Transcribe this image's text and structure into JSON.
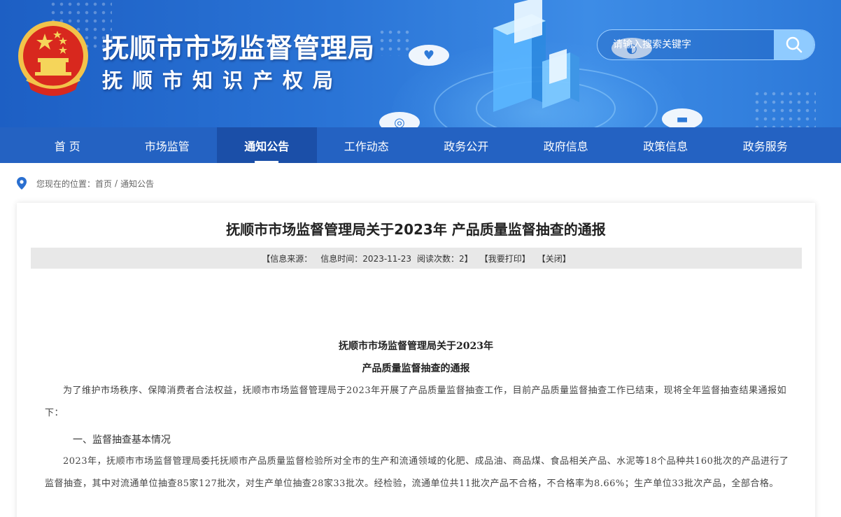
{
  "header": {
    "title_main": "抚顺市市场监督管理局",
    "title_sub": "抚顺市知识产权局",
    "search_placeholder": "请输入搜索关键字",
    "emblem_icon": "national-emblem-icon",
    "search_icon": "search-icon",
    "colors": {
      "banner": "#2a74d6",
      "nav": "#2462c2",
      "nav_active": "#1b4fa8"
    }
  },
  "nav": {
    "items": [
      {
        "label": "首 页"
      },
      {
        "label": "市场监管"
      },
      {
        "label": "通知公告"
      },
      {
        "label": "工作动态"
      },
      {
        "label": "政务公开"
      },
      {
        "label": "政府信息"
      },
      {
        "label": "政策信息"
      },
      {
        "label": "政务服务"
      }
    ],
    "active": "通知公告"
  },
  "breadcrumb": {
    "prefix": "您现在的位置：",
    "home": "首页",
    "separator": "/",
    "current": "通知公告"
  },
  "article": {
    "title": "抚顺市市场监督管理局关于2023年 产品质量监督抽查的通报",
    "meta": {
      "source": "【信息来源：",
      "time": "信息时间：2023-11-23",
      "reads": "阅读次数：2】",
      "print": "【我要打印】",
      "close": "【关闭】"
    },
    "doc_heading_1": "抚顺市市场监督管理局关于2023年",
    "doc_heading_2": "产品质量监督抽查的通报",
    "para_1": "为了维护市场秩序、保障消费者合法权益，抚顺市市场监督管理局于2023年开展了产品质量监督抽查工作，目前产品质量监督抽查工作已结束，现将全年监督抽查结果通报如下：",
    "section_1": "一、监督抽查基本情况",
    "para_2": "2023年，抚顺市市场监督管理局委托抚顺市产品质量监督检验所对全市的生产和流通领域的化肥、成品油、商品煤、食品相关产品、水泥等18个品种共160批次的产品进行了监督抽查，其中对流通单位抽查85家127批次，对生产单位抽查28家33批次。经检验，流通单位共11批次产品不合格，不合格率为8.66%；生产单位33批次产品，全部合格。"
  }
}
